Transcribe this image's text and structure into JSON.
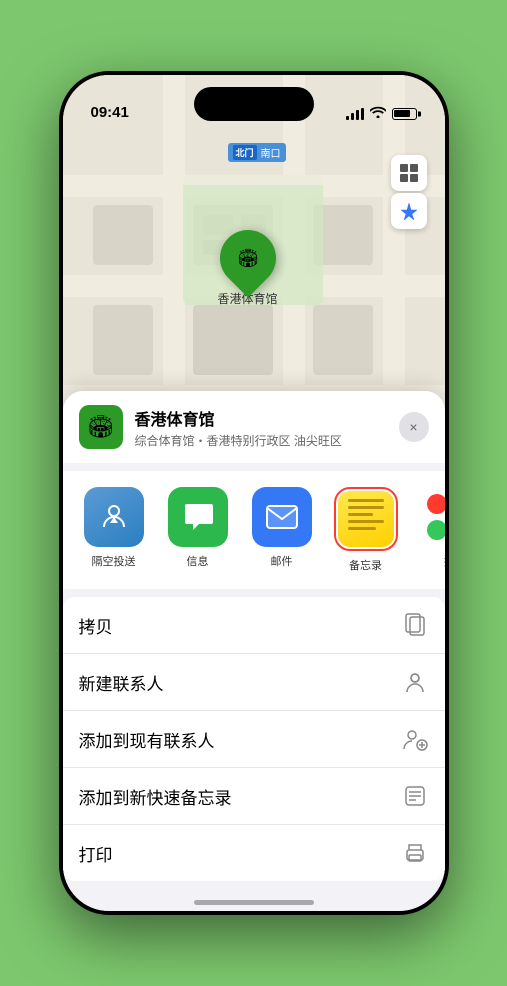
{
  "status_bar": {
    "time": "09:41",
    "location_arrow": "▲"
  },
  "map": {
    "label": "南口",
    "pin_name": "香港体育馆"
  },
  "location_header": {
    "name": "香港体育馆",
    "description": "综合体育馆・香港特别行政区 油尖旺区",
    "close_label": "×"
  },
  "share_items": [
    {
      "id": "airdrop",
      "label": "隔空投送",
      "type": "airdrop"
    },
    {
      "id": "messages",
      "label": "信息",
      "type": "messages"
    },
    {
      "id": "mail",
      "label": "邮件",
      "type": "mail"
    },
    {
      "id": "notes",
      "label": "备忘录",
      "type": "notes"
    },
    {
      "id": "more",
      "label": "提",
      "type": "more"
    }
  ],
  "actions": [
    {
      "id": "copy",
      "label": "拷贝",
      "icon": "copy"
    },
    {
      "id": "new-contact",
      "label": "新建联系人",
      "icon": "person"
    },
    {
      "id": "add-existing",
      "label": "添加到现有联系人",
      "icon": "person-add"
    },
    {
      "id": "add-notes",
      "label": "添加到新快速备忘录",
      "icon": "note"
    },
    {
      "id": "print",
      "label": "打印",
      "icon": "printer"
    }
  ]
}
